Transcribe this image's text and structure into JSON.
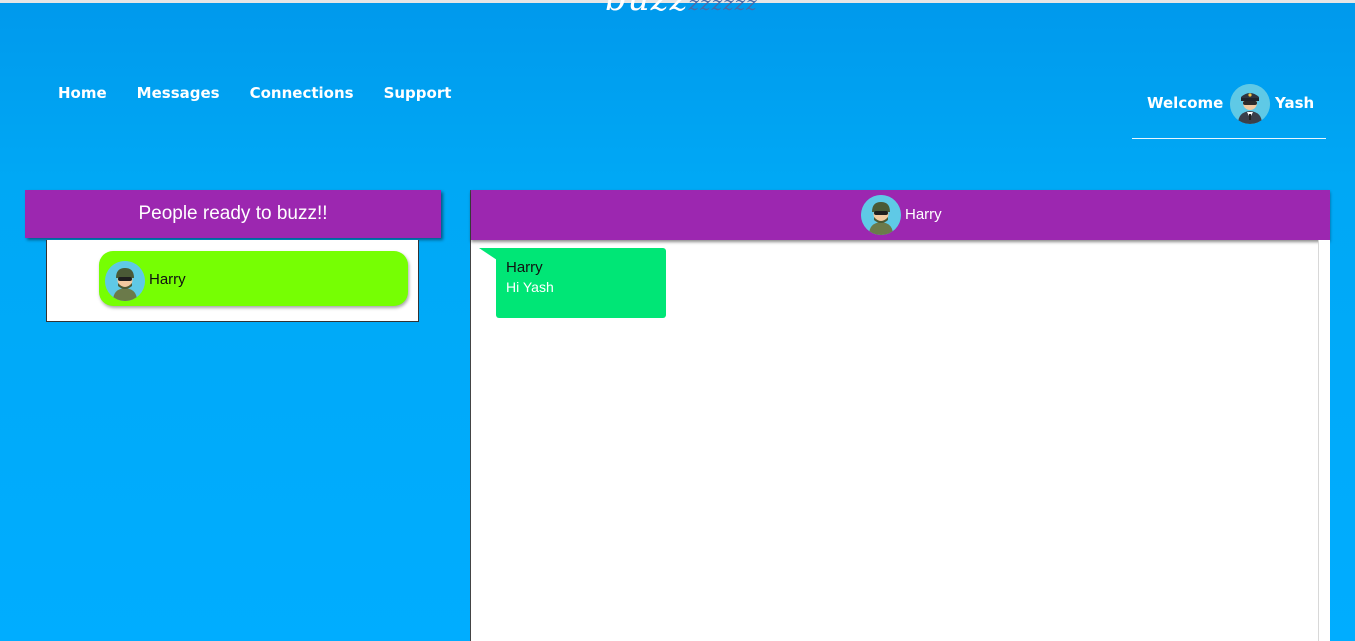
{
  "app": {
    "logo_main": "buzz",
    "logo_tail": "zzzzzz"
  },
  "nav": {
    "items": [
      {
        "label": "Home"
      },
      {
        "label": "Messages"
      },
      {
        "label": "Connections"
      },
      {
        "label": "Support"
      }
    ]
  },
  "user": {
    "welcome_label": "Welcome",
    "name": "Yash",
    "avatar_icon": "pilot-avatar-icon"
  },
  "people_panel": {
    "title": "People ready to buzz!!",
    "people": [
      {
        "name": "Harry",
        "avatar_icon": "soldier-avatar-icon",
        "highlight_color": "#76ff03"
      }
    ]
  },
  "chat": {
    "contact_name": "Harry",
    "messages": [
      {
        "sender": "Harry",
        "text": "Hi Yash",
        "bubble_color": "#00e676"
      }
    ]
  },
  "colors": {
    "background": "#00adff",
    "panel_header": "#9c27b0",
    "selected_person": "#76ff03",
    "message_bubble": "#00e676"
  }
}
